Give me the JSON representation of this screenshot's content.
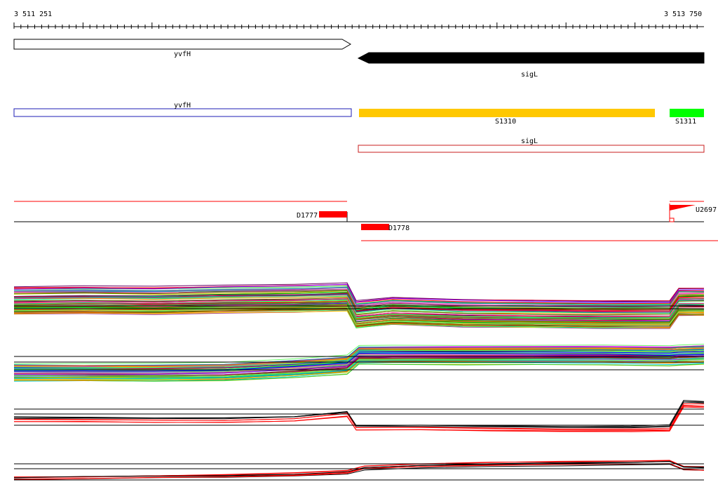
{
  "ruler": {
    "start_label": "3 511 251",
    "end_label": "3 513 750"
  },
  "genes": [
    {
      "name": "yvfH",
      "strand": "forward",
      "style": "outline"
    },
    {
      "name": "sigL",
      "strand": "reverse",
      "style": "filled"
    }
  ],
  "segments": [
    {
      "label": "yvfH",
      "kind": "gene-outline",
      "color": "#1c1cb4"
    },
    {
      "label": "S1310",
      "kind": "segment-filled",
      "color": "#ffc800"
    },
    {
      "label": "S1311",
      "kind": "segment-filled",
      "color": "#00ff00"
    },
    {
      "label": "sigL",
      "kind": "gene-outline",
      "color": "#c81e1e"
    }
  ],
  "features": [
    {
      "label": "D1777",
      "color": "#ff0000"
    },
    {
      "label": "D1778",
      "color": "#ff0000"
    },
    {
      "label": "U2697",
      "color": "#ff0000"
    }
  ],
  "colors": {
    "accent_red": "#ff0000",
    "black": "#000000",
    "gene_outline_blue": "#1c1cb4"
  }
}
